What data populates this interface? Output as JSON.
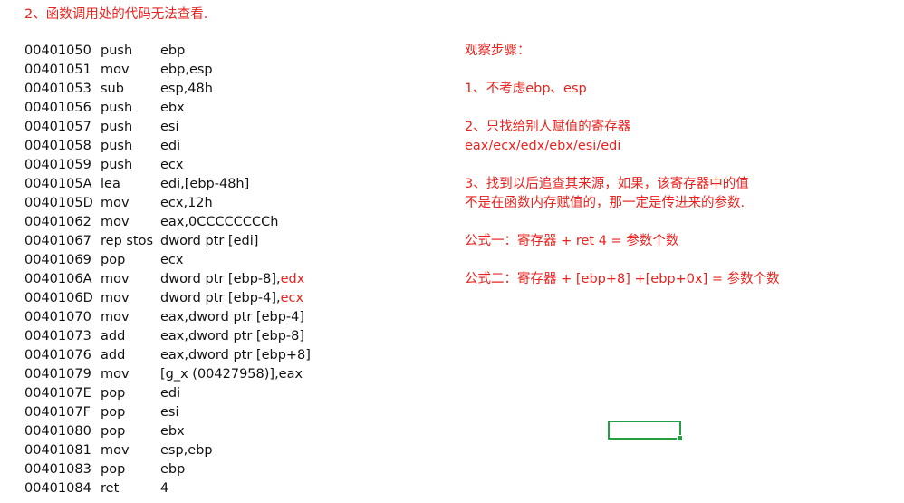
{
  "heading": "2、函数调用处的代码无法查看.",
  "code": [
    {
      "addr": "00401050",
      "mnem": "push",
      "ops": "ebp",
      "hl": ""
    },
    {
      "addr": "00401051",
      "mnem": "mov",
      "ops": "ebp,esp",
      "hl": ""
    },
    {
      "addr": "00401053",
      "mnem": "sub",
      "ops": "esp,48h",
      "hl": ""
    },
    {
      "addr": "00401056",
      "mnem": "push",
      "ops": "ebx",
      "hl": ""
    },
    {
      "addr": "00401057",
      "mnem": "push",
      "ops": "esi",
      "hl": ""
    },
    {
      "addr": "00401058",
      "mnem": "push",
      "ops": "edi",
      "hl": ""
    },
    {
      "addr": "00401059",
      "mnem": "push",
      "ops": "ecx",
      "hl": ""
    },
    {
      "addr": "0040105A",
      "mnem": "lea",
      "ops": "edi,[ebp-48h]",
      "hl": ""
    },
    {
      "addr": "0040105D",
      "mnem": "mov",
      "ops": "ecx,12h",
      "hl": ""
    },
    {
      "addr": "00401062",
      "mnem": "mov",
      "ops": "eax,0CCCCCCCCh",
      "hl": ""
    },
    {
      "addr": "00401067",
      "mnem": "rep stos",
      "ops": "dword ptr [edi]",
      "hl": ""
    },
    {
      "addr": "00401069",
      "mnem": "pop",
      "ops": "ecx",
      "hl": ""
    },
    {
      "addr": "0040106A",
      "mnem": "mov",
      "ops": "dword ptr [ebp-8],",
      "hl": "edx"
    },
    {
      "addr": "0040106D",
      "mnem": "mov",
      "ops": "dword ptr [ebp-4],",
      "hl": "ecx"
    },
    {
      "addr": "00401070",
      "mnem": "mov",
      "ops": "eax,dword ptr [ebp-4]",
      "hl": ""
    },
    {
      "addr": "00401073",
      "mnem": "add",
      "ops": "eax,dword ptr [ebp-8]",
      "hl": ""
    },
    {
      "addr": "00401076",
      "mnem": "add",
      "ops": "eax,dword ptr [ebp+8]",
      "hl": ""
    },
    {
      "addr": "00401079",
      "mnem": "mov",
      "ops": "[g_x (00427958)],eax",
      "hl": ""
    },
    {
      "addr": "0040107E",
      "mnem": "pop",
      "ops": "edi",
      "hl": ""
    },
    {
      "addr": "0040107F",
      "mnem": "pop",
      "ops": "esi",
      "hl": ""
    },
    {
      "addr": "00401080",
      "mnem": "pop",
      "ops": "ebx",
      "hl": ""
    },
    {
      "addr": "00401081",
      "mnem": "mov",
      "ops": "esp,ebp",
      "hl": ""
    },
    {
      "addr": "00401083",
      "mnem": "pop",
      "ops": "ebp",
      "hl": ""
    },
    {
      "addr": "00401084",
      "mnem": "ret",
      "ops": "4",
      "hl": ""
    }
  ],
  "notes": [
    "观察步骤：",
    "",
    "1、不考虑ebp、esp",
    "",
    "2、只找给别人赋值的寄存器",
    "eax/ecx/edx/ebx/esi/edi",
    "",
    "3、找到以后追查其来源，如果，该寄存器中的值",
    "不是在函数内存赋值的，那一定是传进来的参数.",
    "",
    "公式一：寄存器 + ret  4 = 参数个数",
    "",
    "公式二：寄存器 + [ebp+8] +[ebp+0x] = 参数个数"
  ],
  "colors": {
    "note_text": "#e8231f",
    "code_text": "#111111",
    "selection_border": "#22a042"
  }
}
